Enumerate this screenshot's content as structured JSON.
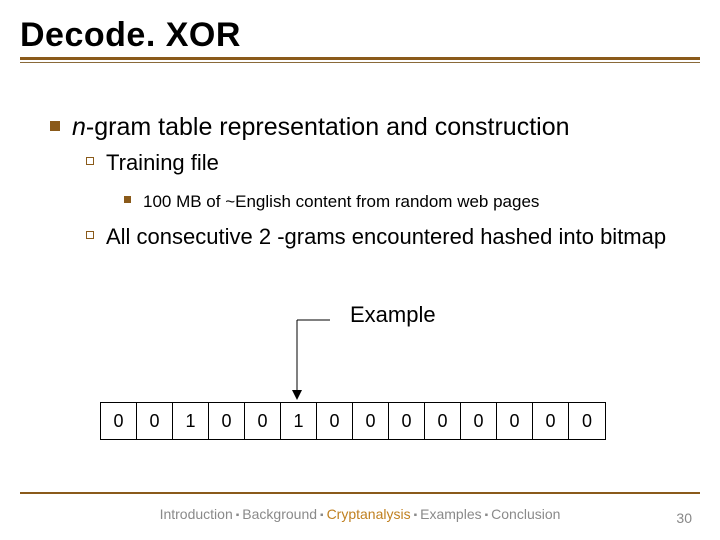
{
  "title": "Decode. XOR",
  "content": {
    "l1_prefix": "n",
    "l1_rest": "-gram table representation and construction",
    "l2a": "Training file",
    "l3a": "100 MB of ~English content from random web pages",
    "l2b": "All consecutive 2 -grams encountered hashed into bitmap"
  },
  "diagram": {
    "label": "Example",
    "cells": [
      "0",
      "0",
      "1",
      "0",
      "0",
      "1",
      "0",
      "0",
      "0",
      "0",
      "0",
      "0",
      "0",
      "0"
    ]
  },
  "footer": {
    "crumbs": [
      "Introduction",
      "Background",
      "Cryptanalysis",
      "Examples",
      "Conclusion"
    ],
    "page": "30"
  }
}
